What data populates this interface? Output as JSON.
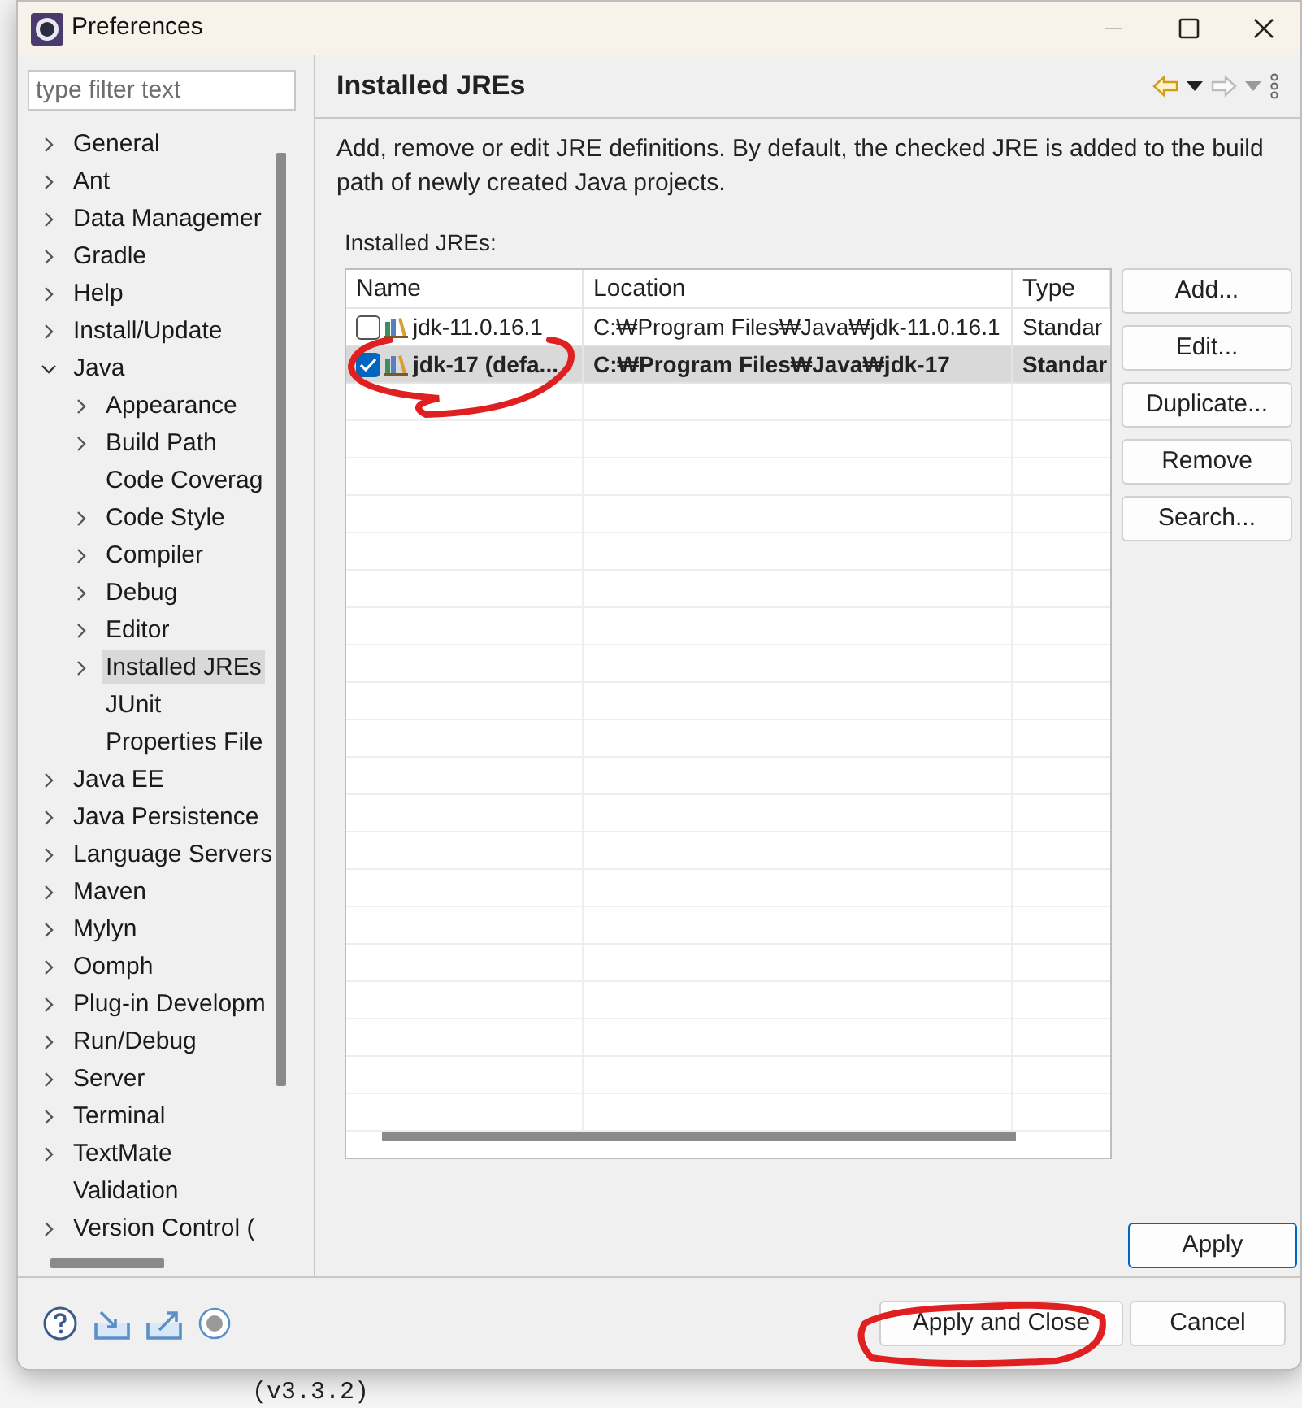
{
  "window": {
    "title": "Preferences"
  },
  "filter": {
    "placeholder": "type filter text"
  },
  "tree": [
    {
      "label": "General",
      "kind": "branch",
      "expanded": false,
      "selected": false
    },
    {
      "label": "Ant",
      "kind": "branch",
      "expanded": false,
      "selected": false
    },
    {
      "label": "Data Managemer",
      "kind": "branch",
      "expanded": false,
      "selected": false
    },
    {
      "label": "Gradle",
      "kind": "branch",
      "expanded": false,
      "selected": false
    },
    {
      "label": "Help",
      "kind": "branch",
      "expanded": false,
      "selected": false
    },
    {
      "label": "Install/Update",
      "kind": "branch",
      "expanded": false,
      "selected": false
    },
    {
      "label": "Java",
      "kind": "branch",
      "expanded": true,
      "selected": false,
      "children": [
        {
          "label": "Appearance",
          "kind": "branch",
          "expanded": false,
          "selected": false
        },
        {
          "label": "Build Path",
          "kind": "branch",
          "expanded": false,
          "selected": false
        },
        {
          "label": "Code Coverag",
          "kind": "leaf",
          "selected": false
        },
        {
          "label": "Code Style",
          "kind": "branch",
          "expanded": false,
          "selected": false
        },
        {
          "label": "Compiler",
          "kind": "branch",
          "expanded": false,
          "selected": false
        },
        {
          "label": "Debug",
          "kind": "branch",
          "expanded": false,
          "selected": false
        },
        {
          "label": "Editor",
          "kind": "branch",
          "expanded": false,
          "selected": false
        },
        {
          "label": "Installed JREs",
          "kind": "branch",
          "expanded": false,
          "selected": true
        },
        {
          "label": "JUnit",
          "kind": "leaf",
          "selected": false
        },
        {
          "label": "Properties File",
          "kind": "leaf",
          "selected": false
        }
      ]
    },
    {
      "label": "Java EE",
      "kind": "branch",
      "expanded": false,
      "selected": false
    },
    {
      "label": "Java Persistence",
      "kind": "branch",
      "expanded": false,
      "selected": false
    },
    {
      "label": "Language Servers",
      "kind": "branch",
      "expanded": false,
      "selected": false
    },
    {
      "label": "Maven",
      "kind": "branch",
      "expanded": false,
      "selected": false
    },
    {
      "label": "Mylyn",
      "kind": "branch",
      "expanded": false,
      "selected": false
    },
    {
      "label": "Oomph",
      "kind": "branch",
      "expanded": false,
      "selected": false
    },
    {
      "label": "Plug-in Developm",
      "kind": "branch",
      "expanded": false,
      "selected": false
    },
    {
      "label": "Run/Debug",
      "kind": "branch",
      "expanded": false,
      "selected": false
    },
    {
      "label": "Server",
      "kind": "branch",
      "expanded": false,
      "selected": false
    },
    {
      "label": "Terminal",
      "kind": "branch",
      "expanded": false,
      "selected": false
    },
    {
      "label": "TextMate",
      "kind": "branch",
      "expanded": false,
      "selected": false
    },
    {
      "label": "Validation",
      "kind": "leaf",
      "selected": false
    },
    {
      "label": "Version Control (",
      "kind": "branch",
      "expanded": false,
      "selected": false
    }
  ],
  "page": {
    "title": "Installed JREs",
    "description": "Add, remove or edit JRE definitions. By default, the checked JRE is added to the build path of newly created Java projects.",
    "table_label": "Installed JREs:"
  },
  "table": {
    "columns": [
      "Name",
      "Location",
      "Type"
    ],
    "rows": [
      {
        "name": "jdk-11.0.16.1",
        "location": "C:₩Program Files₩Java₩jdk-11.0.16.1",
        "type": "Standar",
        "checked": false,
        "selected": false
      },
      {
        "name": "jdk-17 (defa...",
        "location": "C:₩Program Files₩Java₩jdk-17",
        "type": "Standar",
        "checked": true,
        "selected": true
      }
    ]
  },
  "side_buttons": [
    "Add...",
    "Edit...",
    "Duplicate...",
    "Remove",
    "Search..."
  ],
  "apply_button": "Apply",
  "footer_buttons": [
    "Apply and Close",
    "Cancel"
  ],
  "background_text": "(v3.3.2)"
}
